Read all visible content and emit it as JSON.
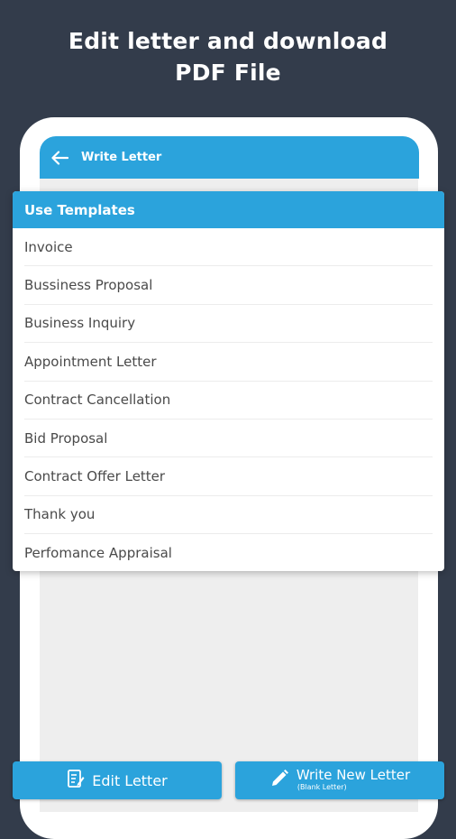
{
  "headline": {
    "line1": "Edit letter and download",
    "line2": "PDF File"
  },
  "appbar": {
    "title": "Write Letter",
    "back_icon": "arrow-left-icon"
  },
  "dialog": {
    "title": "Use Templates",
    "items": [
      {
        "label": "Invoice"
      },
      {
        "label": "Bussiness Proposal"
      },
      {
        "label": "Business Inquiry"
      },
      {
        "label": "Appointment Letter"
      },
      {
        "label": "Contract Cancellation"
      },
      {
        "label": "Bid Proposal"
      },
      {
        "label": "Contract Offer Letter"
      },
      {
        "label": "Thank you"
      },
      {
        "label": "Perfomance Appraisal"
      }
    ]
  },
  "buttons": {
    "edit": {
      "label": "Edit Letter",
      "icon": "document-edit-icon"
    },
    "new": {
      "label": "Write New Letter",
      "sublabel": "(Blank Letter)",
      "icon": "pencil-icon"
    }
  },
  "colors": {
    "background": "#333c4b",
    "accent": "#2ba3dc",
    "list_text": "#4a4a4a"
  }
}
